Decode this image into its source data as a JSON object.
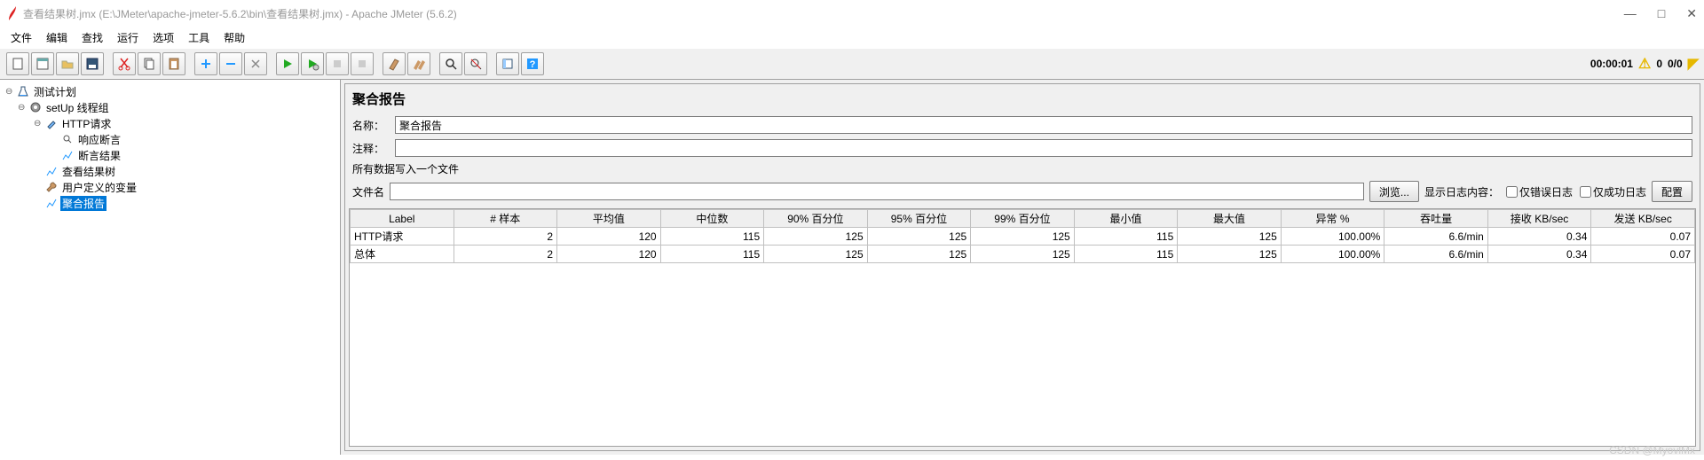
{
  "title": "查看结果树.jmx (E:\\JMeter\\apache-jmeter-5.6.2\\bin\\查看结果树.jmx) - Apache JMeter (5.6.2)",
  "menu": [
    "文件",
    "编辑",
    "查找",
    "运行",
    "选项",
    "工具",
    "帮助"
  ],
  "status": {
    "time": "00:00:01",
    "warn_count": "0",
    "threads": "0/0"
  },
  "tree": {
    "root": "测试计划",
    "group": "setUp 线程组",
    "http": "HTTP请求",
    "resp_assert": "响应断言",
    "assert_res": "断言结果",
    "view_tree": "查看结果树",
    "user_vars": "用户定义的变量",
    "agg_report": "聚合报告"
  },
  "panel": {
    "title": "聚合报告",
    "name_label": "名称：",
    "name_value": "聚合报告",
    "comment_label": "注释：",
    "comment_value": "",
    "write_all_label": "所有数据写入一个文件",
    "file_label": "文件名",
    "file_value": "",
    "browse": "浏览...",
    "show_log": "显示日志内容：",
    "err_only": "仅错误日志",
    "ok_only": "仅成功日志",
    "config": "配置"
  },
  "chart_data": {
    "type": "table",
    "columns": [
      "Label",
      "# 样本",
      "平均值",
      "中位数",
      "90% 百分位",
      "95% 百分位",
      "99% 百分位",
      "最小值",
      "最大值",
      "异常 %",
      "吞吐量",
      "接收 KB/sec",
      "发送 KB/sec"
    ],
    "rows": [
      [
        "HTTP请求",
        "2",
        "120",
        "115",
        "125",
        "125",
        "125",
        "115",
        "125",
        "100.00%",
        "6.6/min",
        "0.34",
        "0.07"
      ],
      [
        "总体",
        "2",
        "120",
        "115",
        "125",
        "125",
        "125",
        "115",
        "125",
        "100.00%",
        "6.6/min",
        "0.34",
        "0.07"
      ]
    ]
  },
  "watermark": "CSDN @MyovlMx"
}
